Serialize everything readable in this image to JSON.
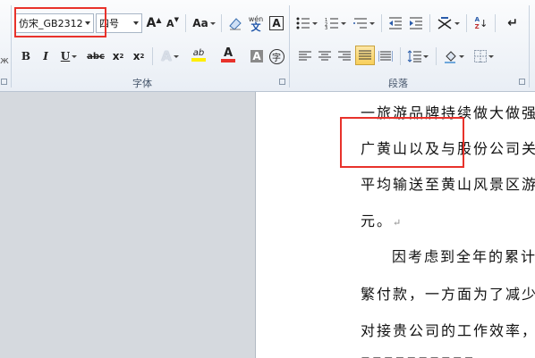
{
  "ribbon": {
    "font_group": {
      "label": "字体",
      "font_name": "仿宋_GB2312",
      "font_size": "四号",
      "grow_font": "A",
      "shrink_font": "A",
      "change_case": "Aa",
      "phonetic": "wén",
      "bold": "B",
      "italic": "I",
      "underline": "U",
      "strike": "abc",
      "subscript": "x",
      "superscript": "x",
      "text_effect": "A",
      "highlight": "ab",
      "font_color": "A",
      "char_shading": "A",
      "enclose": "字"
    },
    "paragraph_group": {
      "label": "段落",
      "sort": "A",
      "sort_z": "Z"
    },
    "left_edge": "ж"
  },
  "document": {
    "lines": [
      "一旅游品牌持续做大做强",
      "广黄山以及与股份公司关",
      "平均输送至黄山风景区游",
      "元。",
      "因考虑到全年的累计",
      "繁付款，一方面为了减少",
      "对接贵公司的工作效率，"
    ],
    "paragraph_mark": "↵"
  },
  "colors": {
    "highlight_yellow": "#ffee00",
    "font_red": "#e8322b",
    "annotation_red": "#e8322b"
  }
}
